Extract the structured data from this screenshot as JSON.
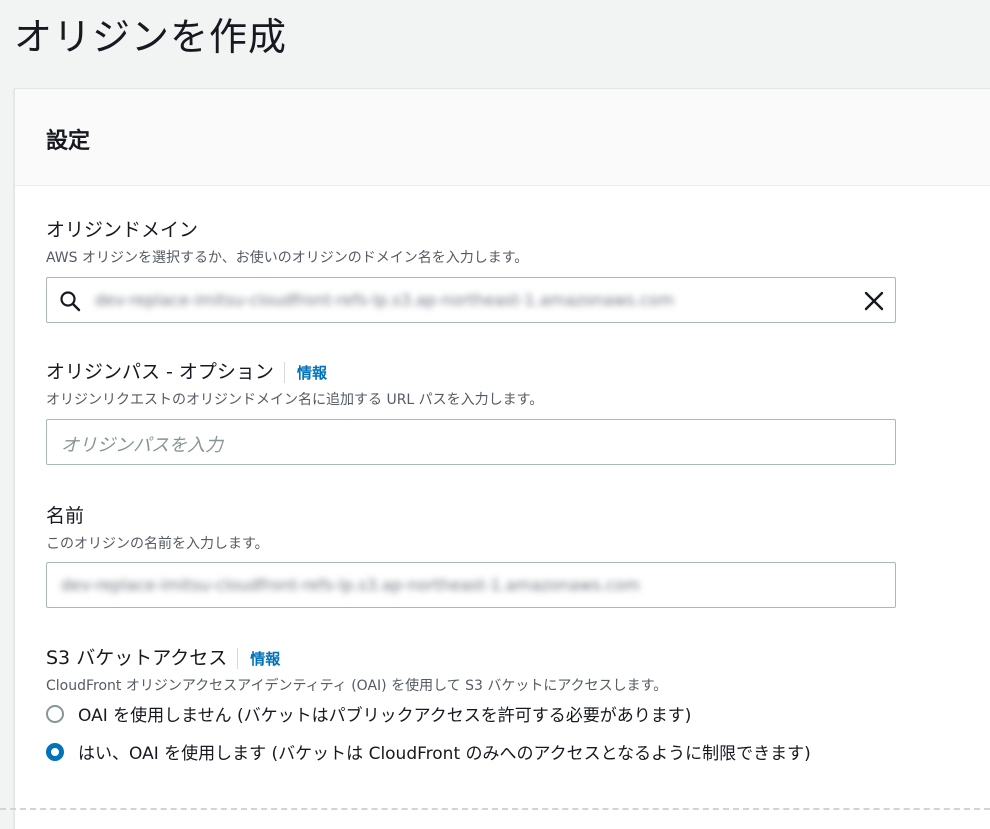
{
  "page": {
    "title": "オリジンを作成"
  },
  "settings": {
    "title": "設定",
    "origin_domain": {
      "label": "オリジンドメイン",
      "description": "AWS オリジンを選択するか、お使いのオリジンのドメイン名を入力します。",
      "value": "dev-replace-imitsu-cloudfront-refs-lp.s3.ap-northeast-1.amazonaws.com",
      "icons": {
        "search": "search-icon",
        "clear": "close-icon"
      }
    },
    "origin_path": {
      "label": "オリジンパス - オプション",
      "info": "情報",
      "description": "オリジンリクエストのオリジンドメイン名に追加する URL パスを入力します。",
      "placeholder": "オリジンパスを入力"
    },
    "name": {
      "label": "名前",
      "description": "このオリジンの名前を入力します。",
      "value": "dev-replace-imitsu-cloudfront-refs-lp.s3.ap-northeast-1.amazonaws.com"
    },
    "s3_access": {
      "label": "S3 バケットアクセス",
      "info": "情報",
      "description": "CloudFront オリジンアクセスアイデンティティ (OAI) を使用して S3 バケットにアクセスします。",
      "options": [
        {
          "label": "OAI を使用しません (バケットはパブリックアクセスを許可する必要があります)",
          "selected": false
        },
        {
          "label": "はい、OAI を使用します (バケットは CloudFront のみへのアクセスとなるように制限できます)",
          "selected": true
        }
      ]
    }
  },
  "colors": {
    "accent": "#0073bb",
    "text": "#16191f",
    "muted": "#545b64"
  }
}
